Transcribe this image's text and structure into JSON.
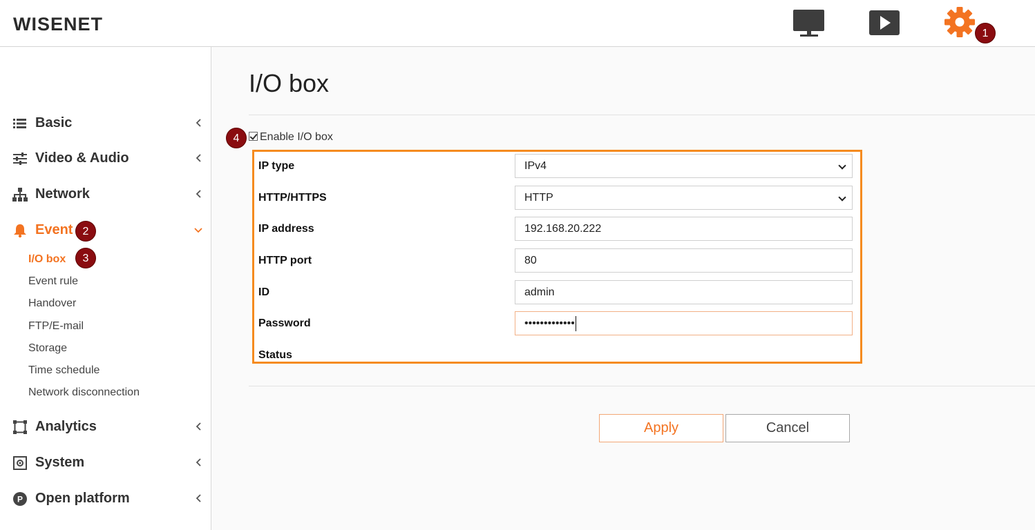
{
  "header": {
    "logo": "WISENET",
    "icons": [
      "monitor-icon",
      "play-icon",
      "gear-icon"
    ],
    "badge_gear": "1"
  },
  "sidebar": {
    "items": [
      {
        "label": "Basic",
        "icon": "list-icon"
      },
      {
        "label": "Video & Audio",
        "icon": "sliders-icon"
      },
      {
        "label": "Network",
        "icon": "network-icon"
      },
      {
        "label": "Event",
        "icon": "bell-icon",
        "badge": "2",
        "active": true
      },
      {
        "label": "Analytics",
        "icon": "analytics-icon"
      },
      {
        "label": "System",
        "icon": "system-icon"
      },
      {
        "label": "Open platform",
        "icon": "open-platform-icon"
      }
    ],
    "event_subitems": [
      {
        "label": "I/O box",
        "badge": "3",
        "active": true
      },
      {
        "label": "Event rule"
      },
      {
        "label": "Handover"
      },
      {
        "label": "FTP/E-mail"
      },
      {
        "label": "Storage"
      },
      {
        "label": "Time schedule"
      },
      {
        "label": "Network disconnection"
      }
    ]
  },
  "main": {
    "title": "I/O box",
    "enable_label": "Enable I/O box",
    "enable_checked": true,
    "enable_badge": "4",
    "form": {
      "ip_type_label": "IP type",
      "ip_type_value": "IPv4",
      "http_label": "HTTP/HTTPS",
      "http_value": "HTTP",
      "ip_address_label": "IP address",
      "ip_address_value": "192.168.20.222",
      "http_port_label": "HTTP port",
      "http_port_value": "80",
      "id_label": "ID",
      "id_value": "admin",
      "password_label": "Password",
      "password_value": "•••••••••••••",
      "status_label": "Status"
    },
    "apply_label": "Apply",
    "cancel_label": "Cancel"
  },
  "colors": {
    "accent": "#f37321",
    "badge": "#8a0c10",
    "form_border": "#f58b1f"
  }
}
